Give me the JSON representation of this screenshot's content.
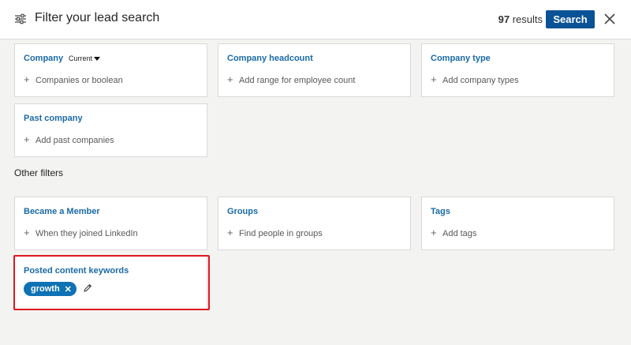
{
  "header": {
    "title": "Filter your lead search",
    "results_count": "97",
    "results_suffix": " results",
    "search_label": "Search",
    "icons": {
      "filter": "sliders-icon",
      "close": "close-icon"
    }
  },
  "filters": {
    "company": {
      "label": "Company",
      "selector": "Current",
      "add": "Companies or boolean"
    },
    "company_headcount": {
      "label": "Company headcount",
      "add": "Add range for employee count"
    },
    "company_type": {
      "label": "Company type",
      "add": "Add company types"
    },
    "past_company": {
      "label": "Past company",
      "add": "Add past companies"
    }
  },
  "other_filters": {
    "label": "Other filters",
    "became_member": {
      "label": "Became a Member",
      "add": "When they joined LinkedIn"
    },
    "groups": {
      "label": "Groups",
      "add": "Find people in groups"
    },
    "tags": {
      "label": "Tags",
      "add": "Add tags"
    },
    "posted_content_keywords": {
      "label": "Posted content keywords",
      "chip": "growth",
      "chip_remove": "✕"
    }
  },
  "colors": {
    "accent": "#0a5296",
    "link": "#1a6aa8",
    "chip": "#0e72b4",
    "highlight": "#e0161f",
    "background": "#f3f3f1"
  }
}
